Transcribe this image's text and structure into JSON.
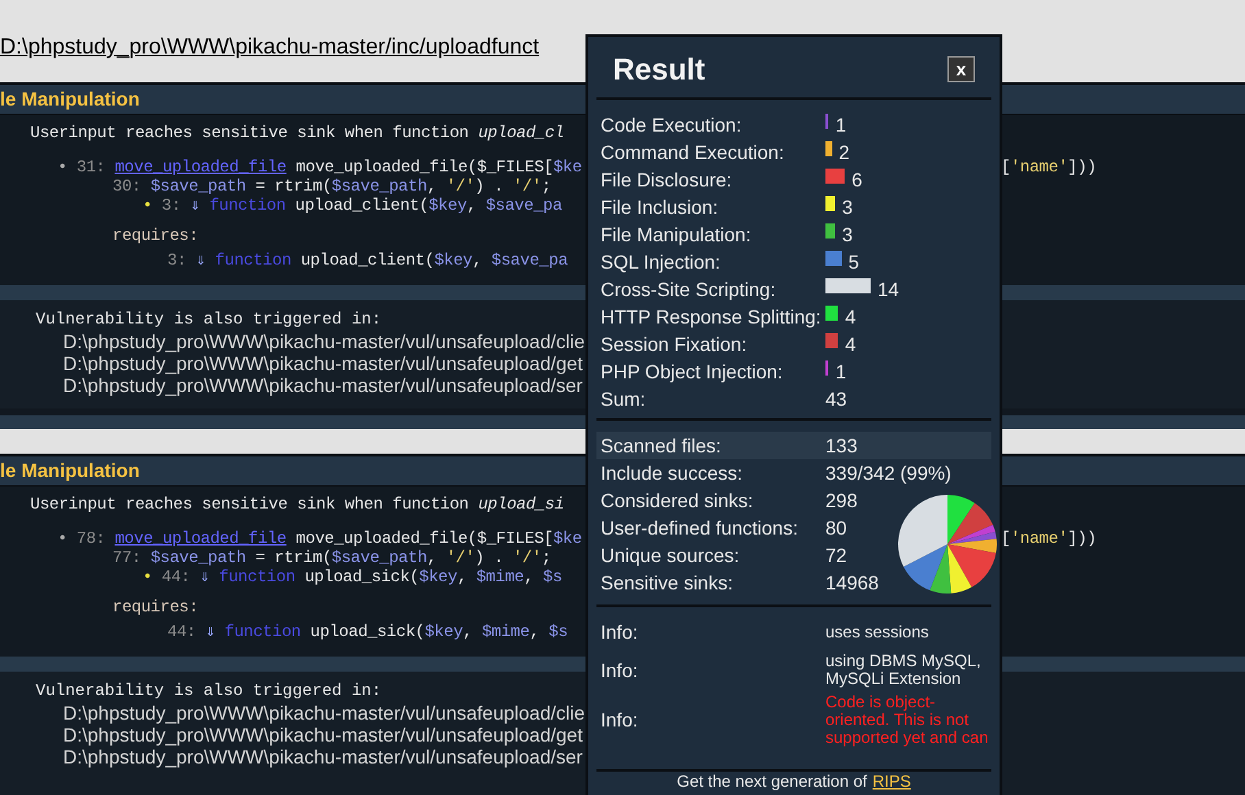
{
  "files": [
    {
      "path": "D:\\phpstudy_pro\\WWW\\pikachu-master/inc/uploadfunct",
      "finding": {
        "title": "le Manipulation",
        "lines": [
          {
            "kind": "desc",
            "tokens": [
              {
                "kind": "plain",
                "t": "Userinput reaches sensitive sink when function "
              },
              {
                "kind": "italic",
                "t": "upload_cl"
              }
            ]
          },
          {
            "kind": "sink",
            "tokens": [
              {
                "kind": "bullet",
                "t": "• "
              },
              {
                "kind": "num",
                "t": "31: "
              },
              {
                "kind": "link",
                "t": "move_uploaded_file"
              },
              {
                "kind": "plain",
                "t": " move_uploaded_file($_FILES["
              },
              {
                "kind": "var",
                "t": "$ke"
              }
            ],
            "tail": [
              {
                "kind": "plain",
                "t": "["
              },
              {
                "kind": "str",
                "t": "'name'"
              },
              {
                "kind": "plain",
                "t": "]))"
              }
            ]
          },
          {
            "kind": "trace",
            "tokens": [
              {
                "kind": "num",
                "t": "30: "
              },
              {
                "kind": "var",
                "t": "$save_path"
              },
              {
                "kind": "plain",
                "t": " = rtrim("
              },
              {
                "kind": "var",
                "t": "$save_path"
              },
              {
                "kind": "plain",
                "t": ", "
              },
              {
                "kind": "str",
                "t": "'/'"
              },
              {
                "kind": "plain",
                "t": ") . "
              },
              {
                "kind": "str",
                "t": "'/'"
              },
              {
                "kind": "plain",
                "t": ";"
              }
            ]
          },
          {
            "kind": "nested",
            "tokens": [
              {
                "kind": "bullet_hi",
                "t": "• "
              },
              {
                "kind": "num",
                "t": "3: "
              },
              {
                "kind": "arrow",
                "t": "⇓ "
              },
              {
                "kind": "kw",
                "t": "function"
              },
              {
                "kind": "plain",
                "t": " upload_client("
              },
              {
                "kind": "var",
                "t": "$key"
              },
              {
                "kind": "plain",
                "t": ", "
              },
              {
                "kind": "var",
                "t": "$save_pa"
              }
            ]
          },
          {
            "kind": "requires",
            "tokens": [
              {
                "kind": "label",
                "t": "requires:"
              }
            ]
          },
          {
            "kind": "required",
            "tokens": [
              {
                "kind": "num",
                "t": "3: "
              },
              {
                "kind": "arrow",
                "t": "⇓ "
              },
              {
                "kind": "kw",
                "t": "function"
              },
              {
                "kind": "plain",
                "t": " upload_client("
              },
              {
                "kind": "var",
                "t": "$key"
              },
              {
                "kind": "plain",
                "t": ", "
              },
              {
                "kind": "var",
                "t": "$save_pa"
              }
            ]
          }
        ],
        "triggered_title": "Vulnerability is also triggered in:",
        "triggered": [
          "D:\\phpstudy_pro\\WWW\\pikachu-master/vul/unsafeupload/clie",
          "D:\\phpstudy_pro\\WWW\\pikachu-master/vul/unsafeupload/get",
          "D:\\phpstudy_pro\\WWW\\pikachu-master/vul/unsafeupload/ser"
        ]
      }
    },
    {
      "finding": {
        "title": "le Manipulation",
        "lines": [
          {
            "kind": "desc",
            "tokens": [
              {
                "kind": "plain",
                "t": "Userinput reaches sensitive sink when function "
              },
              {
                "kind": "italic",
                "t": "upload_si"
              }
            ]
          },
          {
            "kind": "sink",
            "tokens": [
              {
                "kind": "bullet",
                "t": "• "
              },
              {
                "kind": "num",
                "t": "78: "
              },
              {
                "kind": "link",
                "t": "move_uploaded_file"
              },
              {
                "kind": "plain",
                "t": " move_uploaded_file($_FILES["
              },
              {
                "kind": "var",
                "t": "$ke"
              }
            ],
            "tail": [
              {
                "kind": "plain",
                "t": "["
              },
              {
                "kind": "str",
                "t": "'name'"
              },
              {
                "kind": "plain",
                "t": "]))"
              }
            ]
          },
          {
            "kind": "trace",
            "tokens": [
              {
                "kind": "num",
                "t": "77: "
              },
              {
                "kind": "var",
                "t": "$save_path"
              },
              {
                "kind": "plain",
                "t": " = rtrim("
              },
              {
                "kind": "var",
                "t": "$save_path"
              },
              {
                "kind": "plain",
                "t": ", "
              },
              {
                "kind": "str",
                "t": "'/'"
              },
              {
                "kind": "plain",
                "t": ") . "
              },
              {
                "kind": "str",
                "t": "'/'"
              },
              {
                "kind": "plain",
                "t": ";"
              }
            ]
          },
          {
            "kind": "nested",
            "tokens": [
              {
                "kind": "bullet_hi",
                "t": "• "
              },
              {
                "kind": "num",
                "t": "44: "
              },
              {
                "kind": "arrow",
                "t": "⇓ "
              },
              {
                "kind": "kw",
                "t": "function"
              },
              {
                "kind": "plain",
                "t": " upload_sick("
              },
              {
                "kind": "var",
                "t": "$key"
              },
              {
                "kind": "plain",
                "t": ", "
              },
              {
                "kind": "var",
                "t": "$mime"
              },
              {
                "kind": "plain",
                "t": ", "
              },
              {
                "kind": "var",
                "t": "$s"
              }
            ]
          },
          {
            "kind": "requires",
            "tokens": [
              {
                "kind": "label",
                "t": "requires:"
              }
            ]
          },
          {
            "kind": "required",
            "tokens": [
              {
                "kind": "num",
                "t": "44: "
              },
              {
                "kind": "arrow",
                "t": "⇓ "
              },
              {
                "kind": "kw",
                "t": "function"
              },
              {
                "kind": "plain",
                "t": " upload_sick("
              },
              {
                "kind": "var",
                "t": "$key"
              },
              {
                "kind": "plain",
                "t": ", "
              },
              {
                "kind": "var",
                "t": "$mime"
              },
              {
                "kind": "plain",
                "t": ", "
              },
              {
                "kind": "var",
                "t": "$s"
              }
            ]
          }
        ],
        "triggered_title": "Vulnerability is also triggered in:",
        "triggered": [
          "D:\\phpstudy_pro\\WWW\\pikachu-master/vul/unsafeupload/clie",
          "D:\\phpstudy_pro\\WWW\\pikachu-master/vul/unsafeupload/get",
          "D:\\phpstudy_pro\\WWW\\pikachu-master/vul/unsafeupload/ser"
        ]
      }
    }
  ],
  "result": {
    "title": "Result",
    "close": "x",
    "stats": [
      {
        "label": "Code Execution:",
        "count": "1",
        "color": "#8a4fd0"
      },
      {
        "label": "Command Execution:",
        "count": "2",
        "color": "#f0b030"
      },
      {
        "label": "File Disclosure:",
        "count": "6",
        "color": "#e84040"
      },
      {
        "label": "File Inclusion:",
        "count": "3",
        "color": "#f0f030"
      },
      {
        "label": "File Manipulation:",
        "count": "3",
        "color": "#40c040"
      },
      {
        "label": "SQL Injection:",
        "count": "5",
        "color": "#4a7fd0"
      },
      {
        "label": "Cross-Site Scripting:",
        "count": "14",
        "color": "#d8dde2"
      },
      {
        "label": "HTTP Response Splitting:",
        "count": "4",
        "color": "#20e040"
      },
      {
        "label": "Session Fixation:",
        "count": "4",
        "color": "#d04040"
      },
      {
        "label": "PHP Object Injection:",
        "count": "1",
        "color": "#c040d0"
      }
    ],
    "sum": {
      "label": "Sum:",
      "value": "43"
    },
    "summary": [
      {
        "label": "Scanned files:",
        "value": "133",
        "highlighted": true
      },
      {
        "label": "Include success:",
        "value": "339/342 (99%)",
        "highlighted": false
      },
      {
        "label": "Considered sinks:",
        "value": "298",
        "highlighted": false
      },
      {
        "label": "User-defined functions:",
        "value": "80",
        "highlighted": false
      },
      {
        "label": "Unique sources:",
        "value": "72",
        "highlighted": false
      },
      {
        "label": "Sensitive sinks:",
        "value": "14968",
        "highlighted": false
      }
    ],
    "info": [
      {
        "kind": "note",
        "label": "Info:",
        "value": "uses sessions"
      },
      {
        "kind": "note",
        "label": "Info:",
        "value": "using DBMS MySQL, MySQLi Extension"
      },
      {
        "kind": "warning",
        "label": "Info:",
        "value": "Code is object-oriented. This is not supported yet and can"
      }
    ],
    "footer": {
      "text": "Get the next generation of",
      "link": "RIPS"
    }
  }
}
